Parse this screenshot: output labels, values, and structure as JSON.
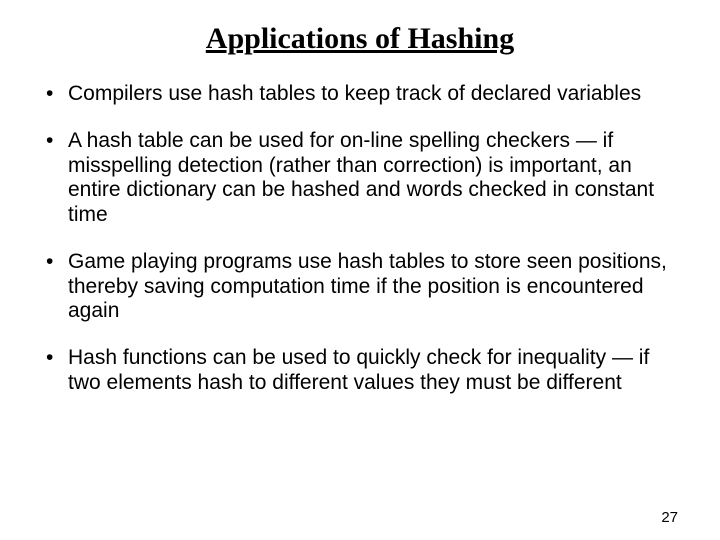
{
  "title": "Applications of Hashing",
  "bullets": [
    "Compilers use hash tables to keep track of declared variables",
    "A hash table can be used for on-line spelling checkers — if misspelling detection (rather than correction) is important, an entire dictionary can be hashed and words checked in constant time",
    "Game playing programs use hash tables to store seen positions, thereby saving computation time if the position is encountered again",
    "Hash functions can be used to quickly check for inequality — if two elements hash to different values they must be different"
  ],
  "page_number": "27"
}
